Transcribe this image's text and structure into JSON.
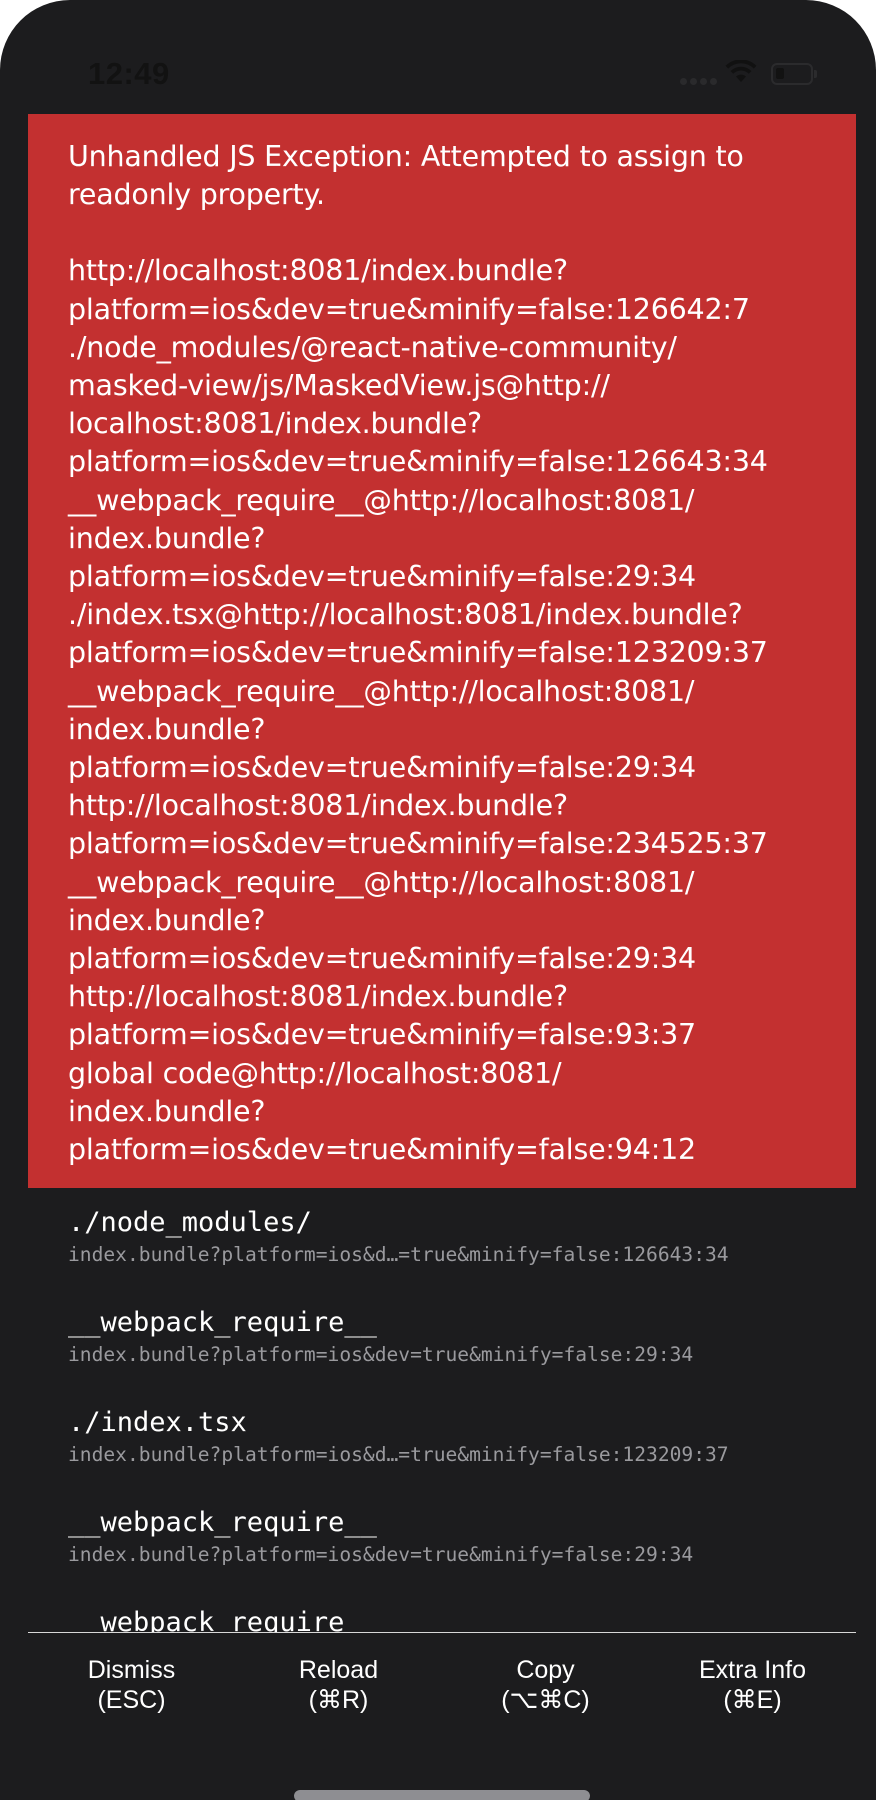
{
  "status_bar": {
    "time": "12:49",
    "icons": [
      "cellular-signal-icon",
      "wifi-icon",
      "battery-icon"
    ]
  },
  "error": {
    "title": "Unhandled JS Exception: Attempted to assign to\nreadonly property.",
    "stack": "http://localhost:8081/index.bundle?\nplatform=ios&dev=true&minify=false:126642:7\n./node_modules/@react-native-community/\nmasked-view/js/MaskedView.js@http://\nlocalhost:8081/index.bundle?\nplatform=ios&dev=true&minify=false:126643:34\n__webpack_require__@http://localhost:8081/\nindex.bundle?\nplatform=ios&dev=true&minify=false:29:34\n./index.tsx@http://localhost:8081/index.bundle?\nplatform=ios&dev=true&minify=false:123209:37\n__webpack_require__@http://localhost:8081/\nindex.bundle?\nplatform=ios&dev=true&minify=false:29:34\nhttp://localhost:8081/index.bundle?\nplatform=ios&dev=true&minify=false:234525:37\n__webpack_require__@http://localhost:8081/\nindex.bundle?\nplatform=ios&dev=true&minify=false:29:34\nhttp://localhost:8081/index.bundle?\nplatform=ios&dev=true&minify=false:93:37\nglobal code@http://localhost:8081/\nindex.bundle?\nplatform=ios&dev=true&minify=false:94:12"
  },
  "frames": [
    {
      "name": "./node_modules/",
      "location": "index.bundle?platform=ios&d…=true&minify=false:126643:34"
    },
    {
      "name": "__webpack_require__",
      "location": "index.bundle?platform=ios&dev=true&minify=false:29:34"
    },
    {
      "name": "./index.tsx",
      "location": "index.bundle?platform=ios&d…=true&minify=false:123209:37"
    },
    {
      "name": "__webpack_require__",
      "location": "index.bundle?platform=ios&dev=true&minify=false:29:34"
    },
    {
      "name": "__webpack_require__",
      "location": ""
    }
  ],
  "toolbar": {
    "dismiss": {
      "label": "Dismiss",
      "shortcut": "(ESC)"
    },
    "reload": {
      "label": "Reload",
      "shortcut": "(⌘R)"
    },
    "copy": {
      "label": "Copy",
      "shortcut": "(⌥⌘C)"
    },
    "extra_info": {
      "label": "Extra Info",
      "shortcut": "(⌘E)"
    }
  },
  "colors": {
    "background": "#1c1c1e",
    "error_panel": "#c33030",
    "text": "#ffffff",
    "secondary_text": "#9a9a9e"
  }
}
